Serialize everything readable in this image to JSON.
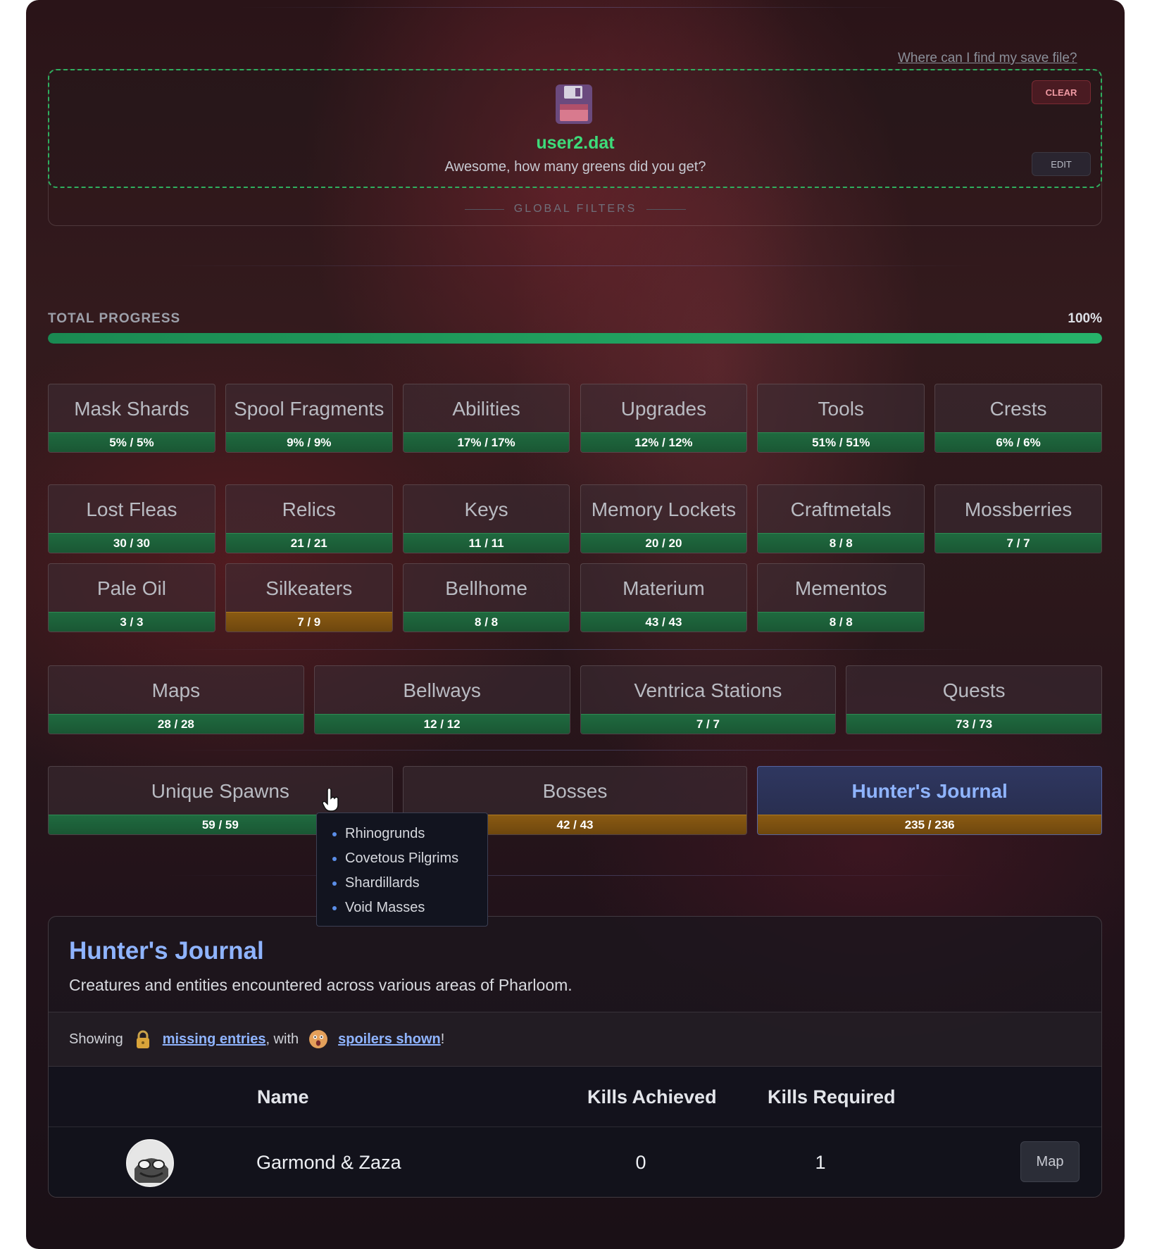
{
  "help_link": "Where can I find my save file?",
  "upload": {
    "filename": "user2.dat",
    "message": "Awesome, how many greens did you get?",
    "clear_label": "CLEAR",
    "edit_label": "EDIT",
    "icon": "floppy-disk-icon"
  },
  "global_filters_label": "GLOBAL FILTERS",
  "total_progress": {
    "label": "TOTAL PROGRESS",
    "value_text": "100%",
    "fraction": 1.0
  },
  "rows": [
    [
      {
        "name": "Mask Shards",
        "progress": "5% / 5%",
        "status": "complete"
      },
      {
        "name": "Spool Fragments",
        "progress": "9% / 9%",
        "status": "complete"
      },
      {
        "name": "Abilities",
        "progress": "17% / 17%",
        "status": "complete"
      },
      {
        "name": "Upgrades",
        "progress": "12% / 12%",
        "status": "complete"
      },
      {
        "name": "Tools",
        "progress": "51% / 51%",
        "status": "complete"
      },
      {
        "name": "Crests",
        "progress": "6% / 6%",
        "status": "complete"
      }
    ],
    [
      {
        "name": "Lost Fleas",
        "progress": "30 / 30",
        "status": "complete"
      },
      {
        "name": "Relics",
        "progress": "21 / 21",
        "status": "complete"
      },
      {
        "name": "Keys",
        "progress": "11 / 11",
        "status": "complete"
      },
      {
        "name": "Memory Lockets",
        "progress": "20 / 20",
        "status": "complete"
      },
      {
        "name": "Craftmetals",
        "progress": "8 / 8",
        "status": "complete"
      },
      {
        "name": "Mossberries",
        "progress": "7 / 7",
        "status": "complete"
      }
    ],
    [
      {
        "name": "Pale Oil",
        "progress": "3 / 3",
        "status": "complete"
      },
      {
        "name": "Silkeaters",
        "progress": "7 / 9",
        "status": "incomplete"
      },
      {
        "name": "Bellhome",
        "progress": "8 / 8",
        "status": "complete"
      },
      {
        "name": "Materium",
        "progress": "43 / 43",
        "status": "complete"
      },
      {
        "name": "Mementos",
        "progress": "8 / 8",
        "status": "complete"
      }
    ],
    [
      {
        "name": "Maps",
        "progress": "28 / 28",
        "status": "complete"
      },
      {
        "name": "Bellways",
        "progress": "12 / 12",
        "status": "complete"
      },
      {
        "name": "Ventrica Stations",
        "progress": "7 / 7",
        "status": "complete"
      },
      {
        "name": "Quests",
        "progress": "73 / 73",
        "status": "complete"
      }
    ],
    [
      {
        "name": "Unique Spawns",
        "progress": "59 / 59",
        "status": "complete"
      },
      {
        "name": "Bosses",
        "progress": "42 / 43",
        "status": "incomplete"
      },
      {
        "name": "Hunter's Journal",
        "progress": "235 / 236",
        "status": "incomplete",
        "active": true
      }
    ]
  ],
  "tooltip_items": [
    "Rhinogrunds",
    "Covetous Pilgrims",
    "Shardillards",
    "Void Masses"
  ],
  "journal": {
    "title": "Hunter's Journal",
    "description": "Creatures and entities encountered across various areas of Pharloom.",
    "filter": {
      "showing": "Showing",
      "missing_link": "missing entries",
      "with": ", with",
      "spoilers_link": "spoilers shown",
      "end": "!",
      "missing_icon": "lock-icon",
      "spoilers_icon": "shocked-face-icon"
    },
    "columns": {
      "name": "Name",
      "achieved": "Kills Achieved",
      "required": "Kills Required"
    },
    "rows": [
      {
        "name": "Garmond & Zaza",
        "achieved": "0",
        "required": "1",
        "map_label": "Map"
      }
    ]
  },
  "colors": {
    "green": "#2fae5e",
    "accent": "#8fb4ff",
    "incomplete": "#8a5a12"
  }
}
